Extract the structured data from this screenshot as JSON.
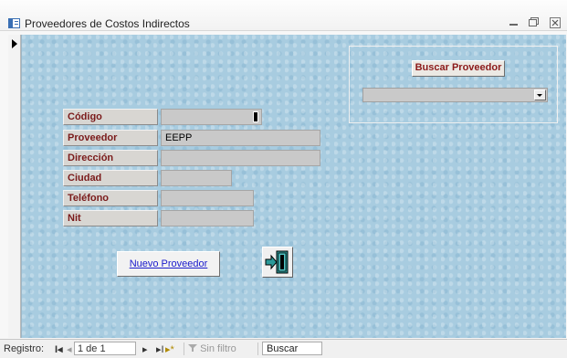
{
  "window": {
    "title": "Proveedores de Costos Indirectos",
    "minimize_glyph": "▭",
    "maximize_glyph": "▢",
    "close_glyph": "☒"
  },
  "form": {
    "fields": [
      {
        "label": "Código",
        "value": ""
      },
      {
        "label": "Proveedor",
        "value": "EEPP"
      },
      {
        "label": "Dirección",
        "value": ""
      },
      {
        "label": "Ciudad",
        "value": ""
      },
      {
        "label": "Teléfono",
        "value": ""
      },
      {
        "label": "Nit",
        "value": ""
      }
    ],
    "search_button": "Buscar Proveedor",
    "search_combo_value": "",
    "new_button": "Nuevo Proveedor"
  },
  "navbar": {
    "label": "Registro:",
    "first": "I◂",
    "prev": "◂",
    "record": "1 de 1",
    "next": "▸",
    "last": "▸I",
    "new": "▸*",
    "filter": "Sin filtro",
    "search": "Buscar"
  },
  "icons": {
    "app": "form-icon",
    "exit": "exit-door-icon",
    "filter": "funnel-icon"
  },
  "colors": {
    "form_background": "#a8cce0",
    "label_text": "#7a1a1a",
    "link_text": "#1a1acc"
  }
}
